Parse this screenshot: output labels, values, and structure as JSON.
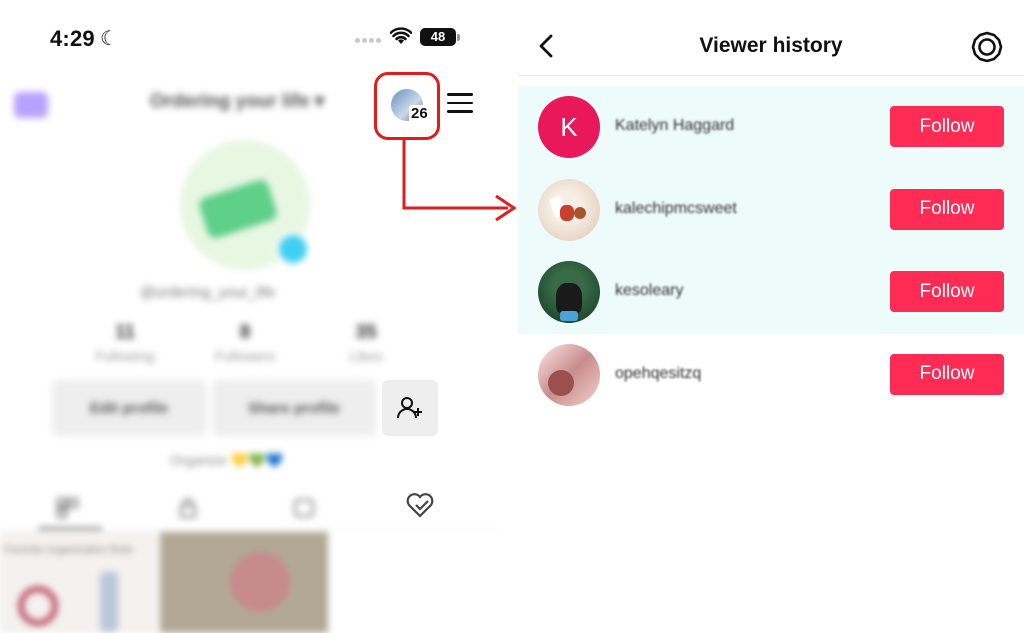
{
  "status_bar": {
    "time": "4:29",
    "battery": "48"
  },
  "profile": {
    "title": "Ordering your life ▾",
    "handle": "@ordering_your_life",
    "stats": [
      {
        "num": "11",
        "label": "Following"
      },
      {
        "num": "8",
        "label": "Followers"
      },
      {
        "num": "35",
        "label": "Likes"
      }
    ],
    "edit_profile_label": "Edit profile",
    "share_profile_label": "Share profile",
    "bio": "Organize 💛💚💙",
    "viewer_count": "26",
    "grid_caption": "Favorite organization finds"
  },
  "viewer_history": {
    "title": "Viewer history",
    "viewers": [
      {
        "initial": "K",
        "name": "Katelyn Haggard",
        "follow_label": "Follow",
        "highlighted": true
      },
      {
        "initial": "",
        "name": "kalechipmcsweet",
        "follow_label": "Follow",
        "highlighted": true
      },
      {
        "initial": "",
        "name": "kesoleary",
        "follow_label": "Follow",
        "highlighted": true
      },
      {
        "initial": "",
        "name": "opehqesitzq",
        "follow_label": "Follow",
        "highlighted": false
      }
    ]
  },
  "colors": {
    "follow_button": "#fe2c55",
    "highlight_row": "#eefbfb",
    "annotation_red": "#e21b1b"
  },
  "icons": [
    "moon-icon",
    "wifi-icon",
    "menu-icon",
    "back-icon",
    "settings-icon",
    "add-friend-icon"
  ]
}
